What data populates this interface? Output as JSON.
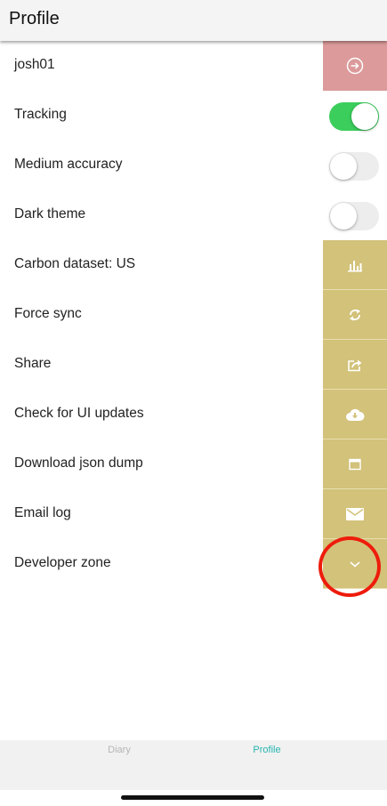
{
  "header": {
    "title": "Profile"
  },
  "rows": [
    {
      "label": "josh01",
      "action": "logout"
    },
    {
      "label": "Tracking",
      "toggle": true
    },
    {
      "label": "Medium accuracy",
      "toggle": false
    },
    {
      "label": "Dark theme",
      "toggle": false
    },
    {
      "label": "Carbon dataset: US",
      "icon": "bar-chart-icon"
    },
    {
      "label": "Force sync",
      "icon": "sync-icon"
    },
    {
      "label": "Share",
      "icon": "share-icon"
    },
    {
      "label": "Check for UI updates",
      "icon": "cloud-download-icon"
    },
    {
      "label": "Download json dump",
      "icon": "calendar-icon"
    },
    {
      "label": "Email log",
      "icon": "mail-icon"
    },
    {
      "label": "Developer zone",
      "icon": "chevron-down-icon"
    }
  ],
  "tabs": [
    {
      "label": "Diary",
      "active": false
    },
    {
      "label": "Profile",
      "active": true
    }
  ],
  "colors": {
    "action_gold": "#d2c27a",
    "action_red": "#dc9a9a",
    "toggle_on": "#3bce5c",
    "tab_active": "#26b5b0",
    "highlight_circle": "#ee1c0c"
  }
}
